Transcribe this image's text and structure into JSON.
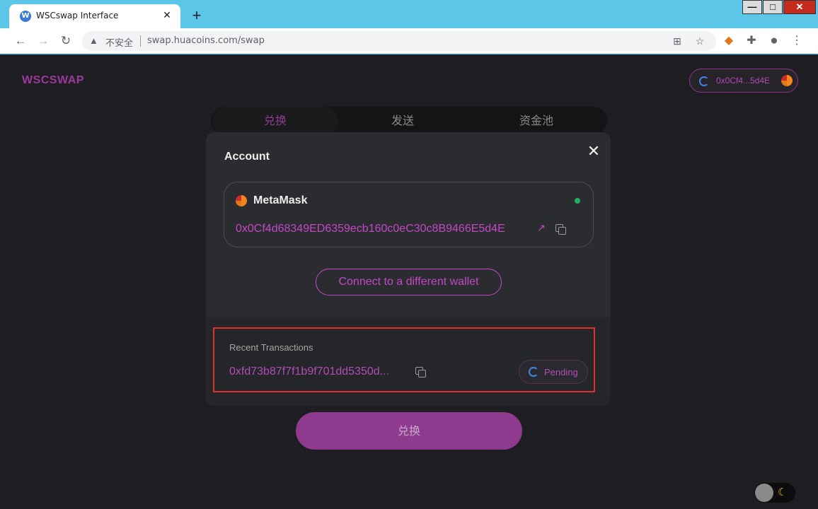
{
  "browser": {
    "tab_title": "WSCswap Interface",
    "tab_favicon": "W",
    "tab_close": "✕",
    "new_tab": "+",
    "security_label": "不安全",
    "url": "swap.huacoins.com/swap",
    "window_buttons": {
      "minimize": "—",
      "maximize": "□",
      "close": "✕"
    },
    "icons": [
      "back-icon",
      "forward-icon",
      "reload-icon",
      "translate-icon",
      "star-icon",
      "metamask-extension-icon",
      "puzzle-icon",
      "profile-icon",
      "menu-icon"
    ]
  },
  "header": {
    "logo": "WSCSWAP",
    "wallet_short": "0x0Cf4...5d4E"
  },
  "nav": {
    "tabs": [
      {
        "label": "兑换",
        "active": true
      },
      {
        "label": "发送",
        "active": false
      },
      {
        "label": "资金池",
        "active": false
      }
    ]
  },
  "swap": {
    "button_label": "兑换"
  },
  "modal": {
    "title": "Account",
    "close": "✕",
    "wallet_name": "MetaMask",
    "address": "0x0Cf4d68349ED6359ecb160c0eC30c8B9466E5d4E",
    "external_link": "↗",
    "connect_label": "Connect to a different wallet",
    "recent": {
      "title": "Recent Transactions",
      "tx_hash": "0xfd73b87f7f1b9f701dd5350d...",
      "status": "Pending"
    }
  },
  "theme_toggle": {
    "mode": "dark",
    "icon": "moon-icon"
  },
  "colors": {
    "accent": "#c547c9",
    "brand": "#9b3a9e",
    "highlight_border": "#e03030",
    "status_connected": "#27ae60"
  }
}
